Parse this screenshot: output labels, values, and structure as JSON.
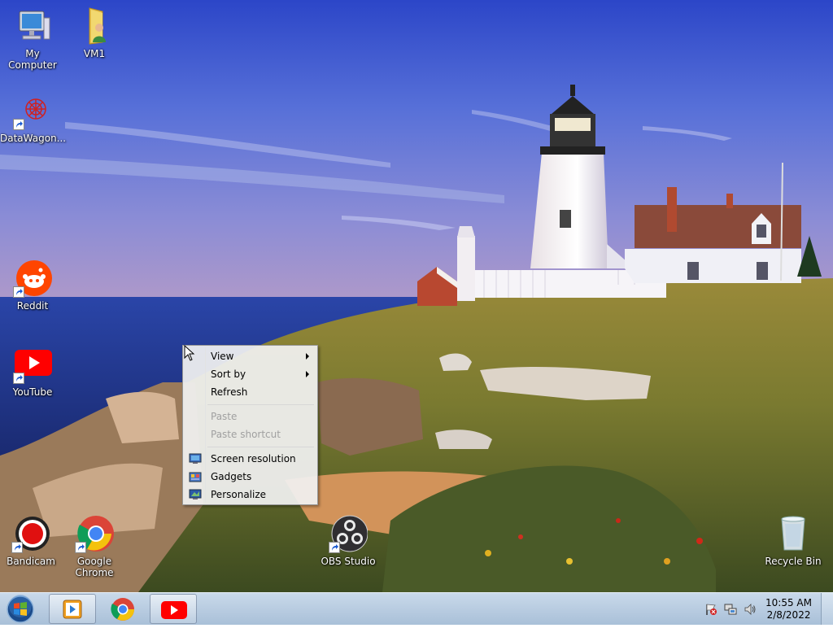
{
  "desktop": {
    "icons": [
      {
        "label": "My Computer",
        "icon": "computer-icon"
      },
      {
        "label": "VM1",
        "icon": "user-folder-icon"
      },
      {
        "label": "DataWagon...",
        "icon": "datawagon-icon"
      },
      {
        "label": "Reddit",
        "icon": "reddit-icon"
      },
      {
        "label": "YouTube",
        "icon": "youtube-icon"
      },
      {
        "label": "Bandicam",
        "icon": "bandicam-icon"
      },
      {
        "label": "Google Chrome",
        "icon": "chrome-icon"
      },
      {
        "label": "OBS Studio",
        "icon": "obs-icon"
      },
      {
        "label": "Recycle Bin",
        "icon": "recycle-bin-icon"
      }
    ]
  },
  "context_menu": {
    "items": [
      {
        "label": "View",
        "submenu": true,
        "enabled": true
      },
      {
        "label": "Sort by",
        "submenu": true,
        "enabled": true
      },
      {
        "label": "Refresh",
        "enabled": true
      },
      {
        "label": "Paste",
        "enabled": false
      },
      {
        "label": "Paste shortcut",
        "enabled": false
      },
      {
        "label": "Screen resolution",
        "icon": "screen-resolution-icon",
        "enabled": true
      },
      {
        "label": "Gadgets",
        "icon": "gadgets-icon",
        "enabled": true
      },
      {
        "label": "Personalize",
        "icon": "personalize-icon",
        "enabled": true
      }
    ]
  },
  "taskbar": {
    "start": "windows-start-icon",
    "pinned": [
      {
        "name": "media-player-icon",
        "active": true
      },
      {
        "name": "chrome-icon",
        "active": false
      },
      {
        "name": "youtube-icon",
        "active": true
      }
    ],
    "tray": {
      "icons": [
        "action-center-flag-icon",
        "network-icon",
        "volume-icon"
      ],
      "time": "10:55 AM",
      "date": "2/8/2022"
    }
  },
  "colors": {
    "taskbar": "#b4c8dd",
    "youtube_red": "#ff0000",
    "reddit_orange": "#ff4500"
  }
}
